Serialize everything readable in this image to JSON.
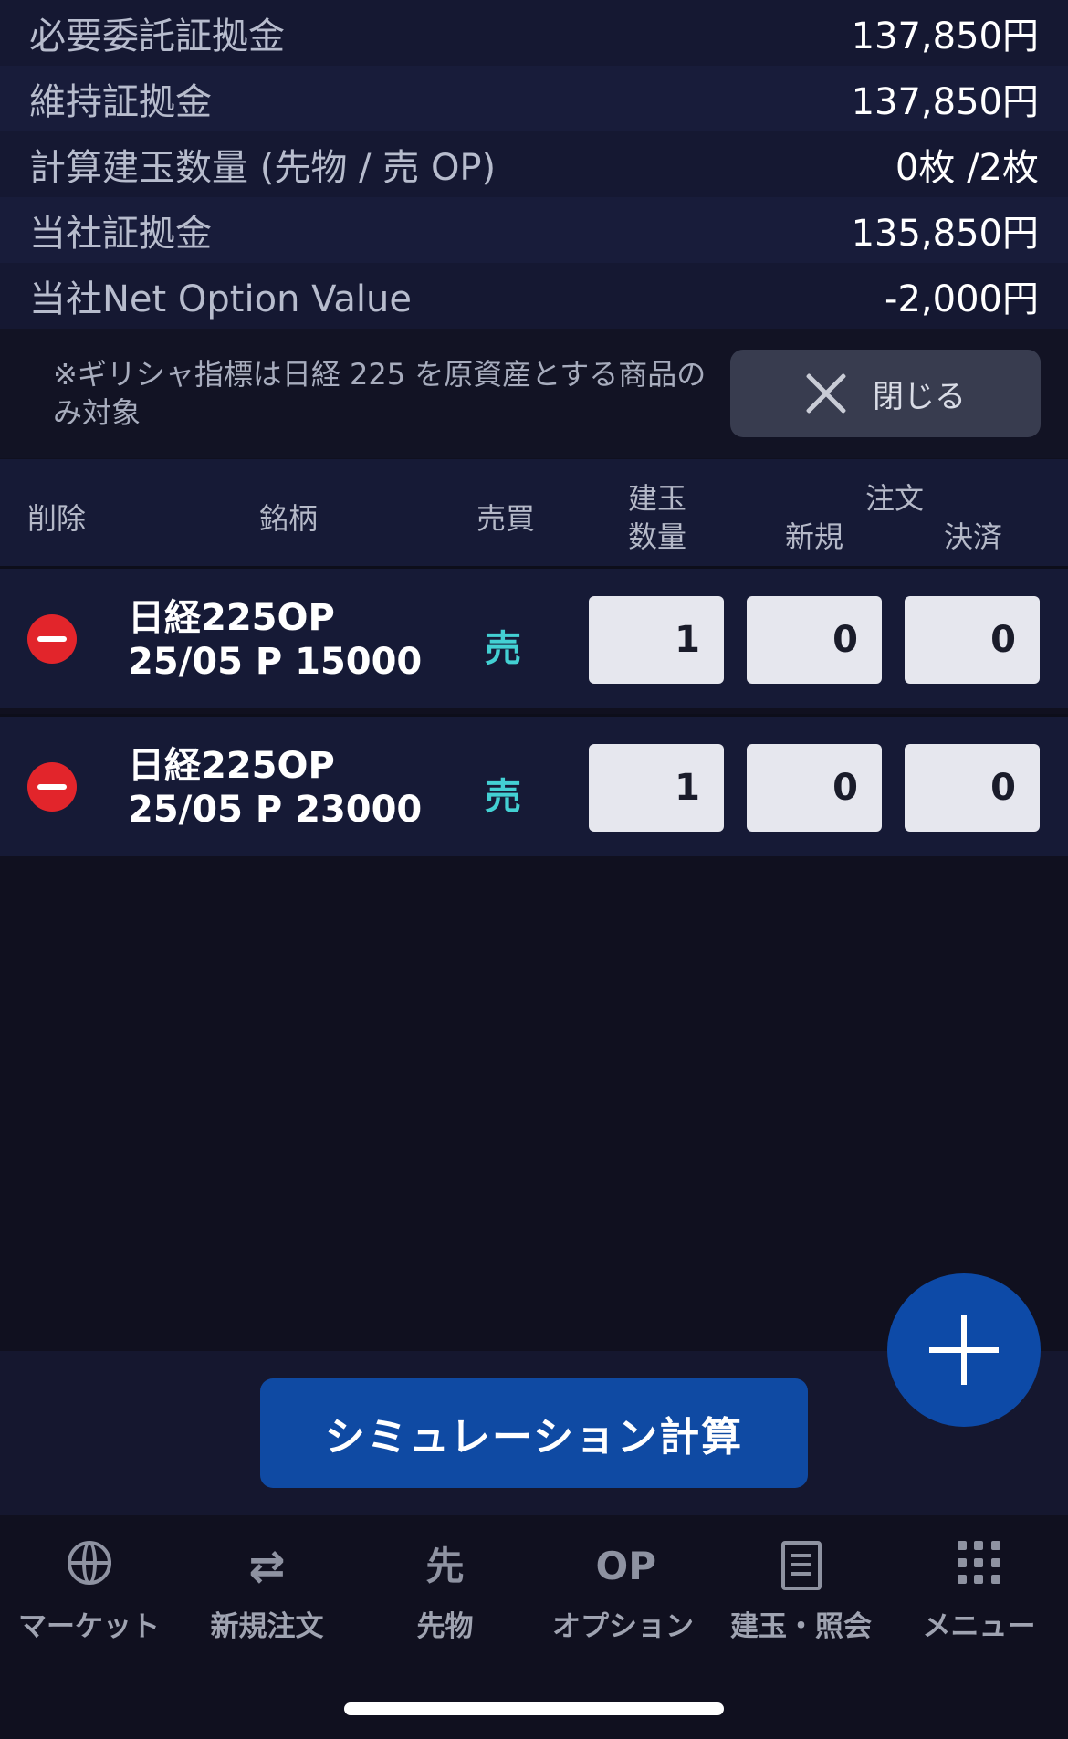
{
  "summary": [
    {
      "label": "必要委託証拠金",
      "value": "137,850円"
    },
    {
      "label": "維持証拠金",
      "value": "137,850円"
    },
    {
      "label": "計算建玉数量 (先物 / 売 OP)",
      "value": "0枚 /2枚"
    },
    {
      "label": "当社証拠金",
      "value": "135,850円"
    },
    {
      "label": "当社Net Option Value",
      "value": "-2,000円"
    }
  ],
  "note": {
    "text": "※ギリシャ指標は日経 225 を原資産とする商品のみ対象",
    "close_label": "閉じる"
  },
  "table": {
    "headers": {
      "delete": "削除",
      "symbol": "銘柄",
      "side": "売買",
      "position_qty_line1": "建玉",
      "position_qty_line2": "数量",
      "order": "注文",
      "new": "新規",
      "settle": "決済"
    },
    "rows": [
      {
        "name_line1": "日経225OP",
        "name_line2": "25/05 P 15000",
        "side": "売",
        "position": "1",
        "new": "0",
        "settle": "0"
      },
      {
        "name_line1": "日経225OP",
        "name_line2": "25/05 P 23000",
        "side": "売",
        "position": "1",
        "new": "0",
        "settle": "0"
      }
    ]
  },
  "simulation_button": "シミュレーション計算",
  "nav": {
    "items": [
      {
        "label": "マーケット",
        "icon": "globe-icon"
      },
      {
        "label": "新規注文",
        "icon": "swap-arrows-icon"
      },
      {
        "label": "先物",
        "icon": "futures-icon",
        "glyph": "先"
      },
      {
        "label": "オプション",
        "icon": "option-icon",
        "glyph": "OP"
      },
      {
        "label": "建玉・照会",
        "icon": "document-icon"
      },
      {
        "label": "メニュー",
        "icon": "grid-menu-icon"
      }
    ]
  },
  "colors": {
    "background": "#10101f",
    "panel": "#161a36",
    "sell": "#43d0d3",
    "accent_blue": "#0f4aa3",
    "delete_red": "#e2252b"
  }
}
